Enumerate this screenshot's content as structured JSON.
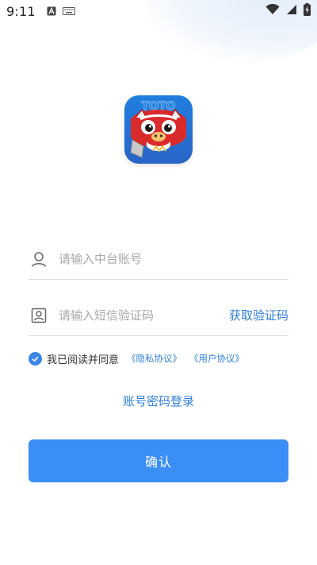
{
  "status_bar": {
    "time": "9:11",
    "icons": [
      "a-box-icon",
      "keyboard-icon",
      "wifi-icon",
      "signal-icon",
      "battery-charging-icon"
    ]
  },
  "logo": {
    "icon": "lion-dance-mascot-logo",
    "lettering": "TOTO"
  },
  "account_field": {
    "icon": "user-icon",
    "placeholder": "请输入中台账号",
    "value": ""
  },
  "code_field": {
    "icon": "id-card-icon",
    "placeholder": "请输入短信验证码",
    "value": "",
    "get_code_label": "获取验证码"
  },
  "agreement": {
    "checked": true,
    "text": "我已阅读并同意",
    "privacy_link": "《隐私协议》",
    "user_link": "《用户协议》"
  },
  "password_login_label": "账号密码登录",
  "confirm_label": "确认",
  "colors": {
    "primary": "#3a8ef5",
    "link": "#2f7fd8",
    "divider": "#dcdcdc",
    "placeholder": "#a8a8a8"
  }
}
